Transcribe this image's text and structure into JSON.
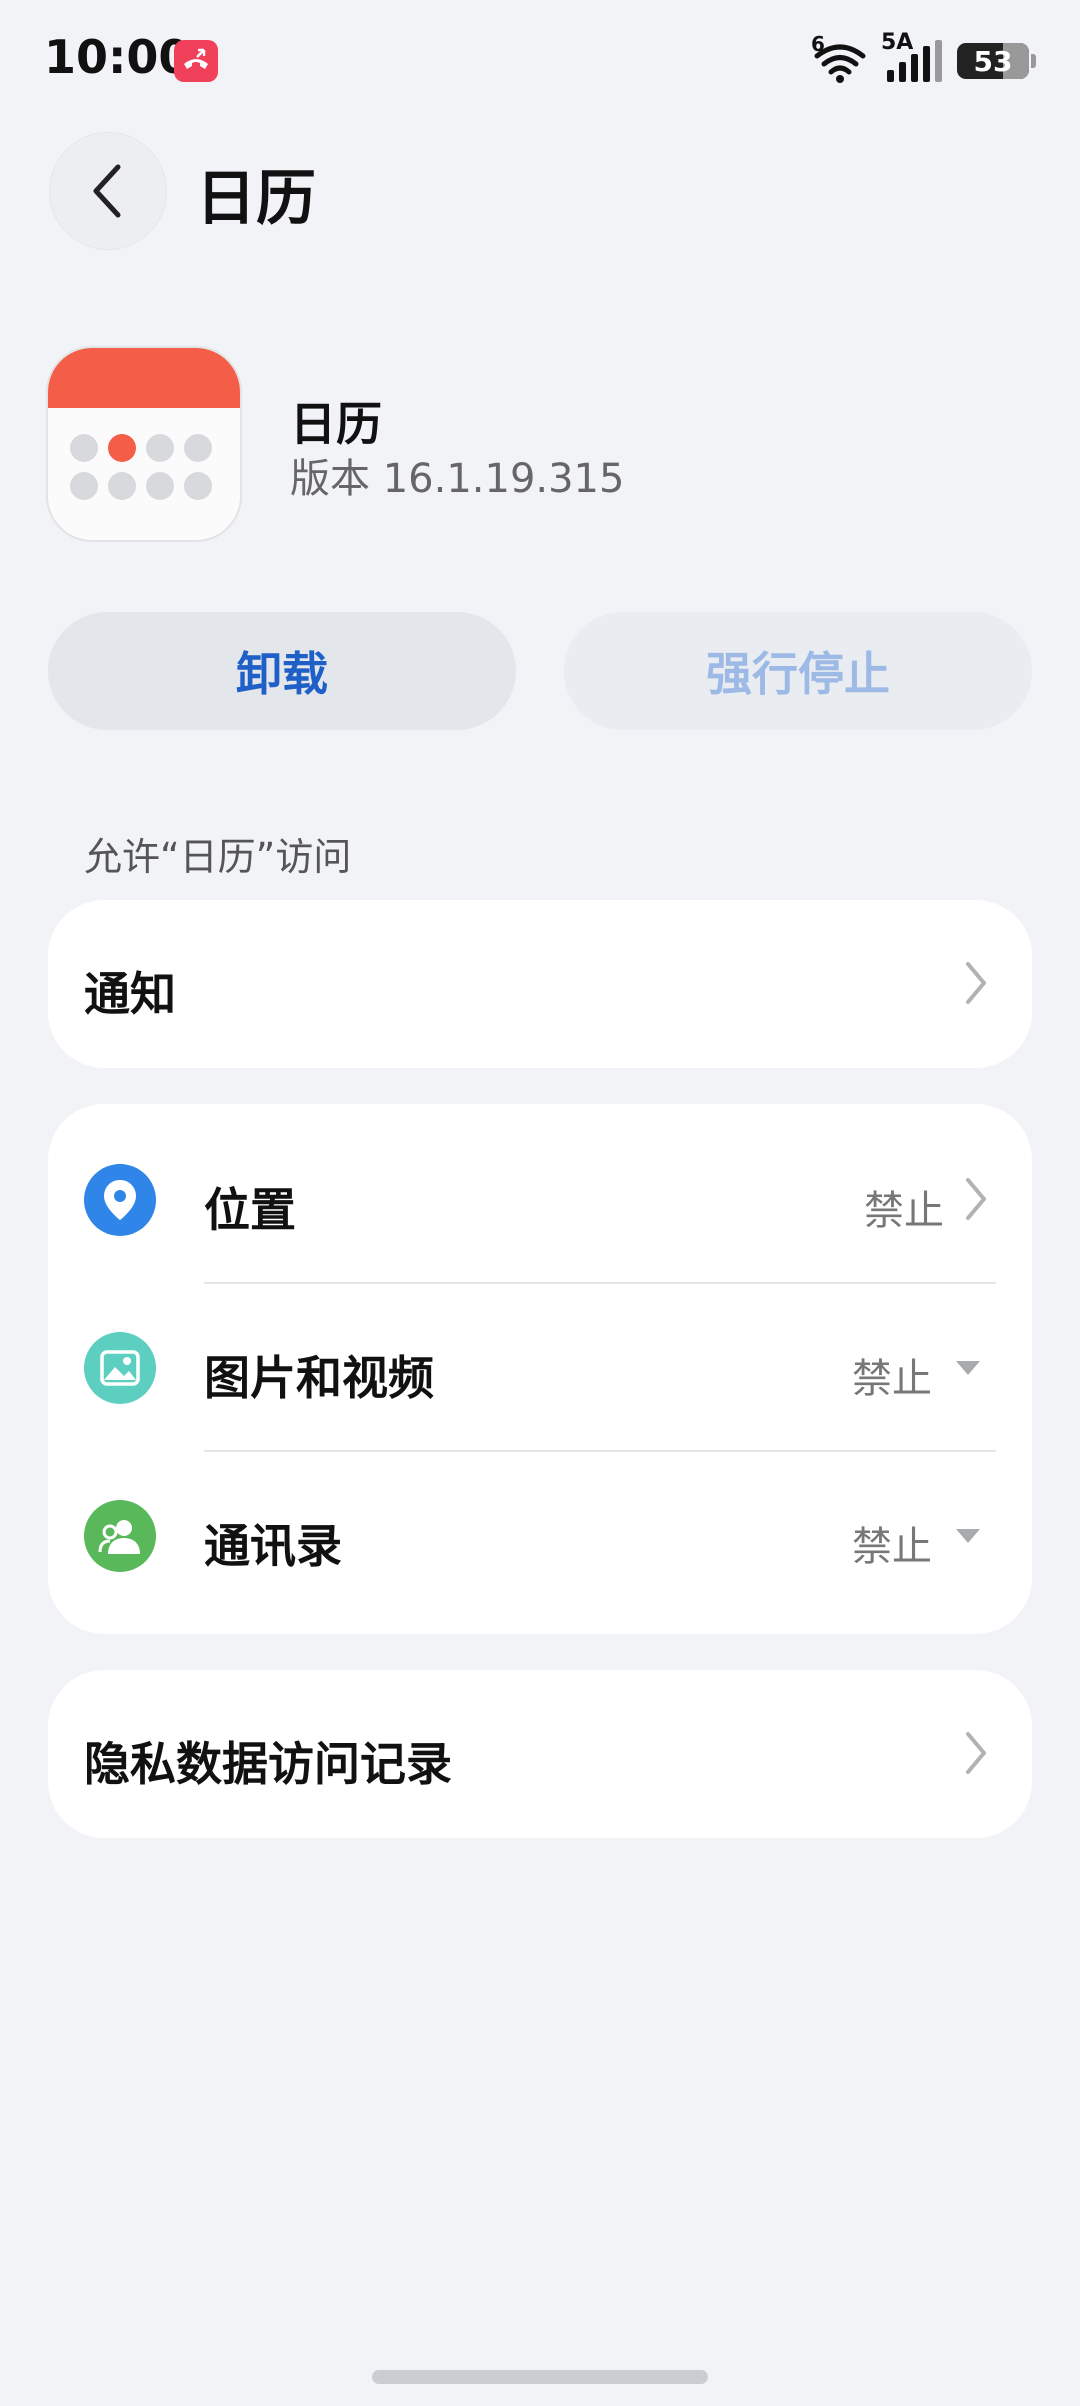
{
  "status_bar": {
    "time": "10:00",
    "network_label": "5A",
    "wifi_label": "6",
    "battery": "53"
  },
  "header": {
    "title": "日历"
  },
  "app": {
    "name": "日历",
    "version": "版本 16.1.19.315"
  },
  "actions": {
    "uninstall": "卸载",
    "force_stop": "强行停止"
  },
  "permissions": {
    "section_label": "允许“日历”访问",
    "notification": "通知",
    "items": [
      {
        "label": "位置",
        "value": "禁止",
        "icon": "location-pin-icon",
        "color": "#2f86e8"
      },
      {
        "label": "图片和视频",
        "value": "禁止",
        "icon": "image-icon",
        "color": "#5ccfc0"
      },
      {
        "label": "通讯录",
        "value": "禁止",
        "icon": "contacts-icon",
        "color": "#58b85a"
      }
    ],
    "privacy_log": "隐私数据访问记录"
  },
  "colors": {
    "background": "#f1f3f7",
    "accent": "#1f5fc8",
    "disabled": "#9db9e5",
    "app_red": "#f45d48"
  }
}
